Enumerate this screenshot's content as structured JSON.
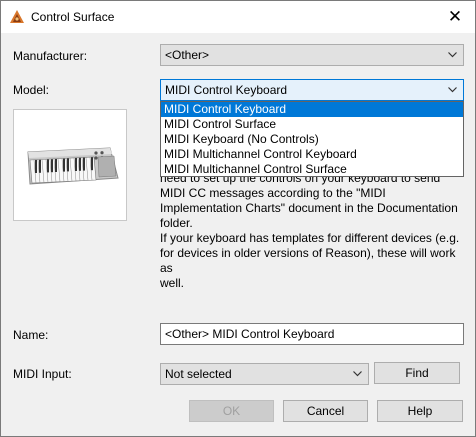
{
  "window": {
    "title": "Control Surface",
    "close_glyph": "✕"
  },
  "manufacturer": {
    "label": "Manufacturer:",
    "value": "<Other>"
  },
  "model": {
    "label": "Model:",
    "value": "MIDI Control Keyboard",
    "options": [
      "MIDI Control Keyboard",
      "MIDI Control Surface",
      "MIDI Keyboard (No Controls)",
      "MIDI Multichannel Control Keyboard",
      "MIDI Multichannel Control Surface"
    ],
    "selected_index": 0
  },
  "description": {
    "partial_line": "need to set up the controls on your keyboard to send",
    "line2": "MIDI CC messages according to the \"MIDI",
    "line3": "Implementation Charts\" document in the Documentation",
    "line4": "folder.",
    "line5": "If your keyboard has templates for different devices (e.g.",
    "line6": "for devices in older versions of Reason), these will work as",
    "line7": "well."
  },
  "name": {
    "label": "Name:",
    "value": "<Other> MIDI Control Keyboard"
  },
  "midi_input": {
    "label": "MIDI Input:",
    "value": "Not selected",
    "find_label": "Find"
  },
  "buttons": {
    "ok": "OK",
    "cancel": "Cancel",
    "help": "Help"
  },
  "icons": {
    "app": "reason-app-icon",
    "device": "midi-keyboard-image"
  },
  "colors": {
    "selection": "#0078d7",
    "focus_border": "#0078d7"
  }
}
